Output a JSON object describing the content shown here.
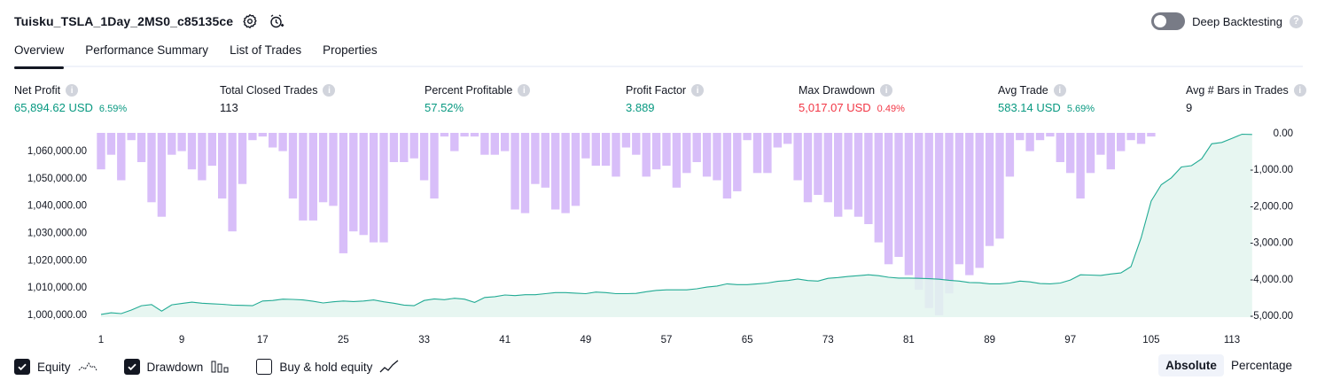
{
  "header": {
    "strategy_name": "Tuisku_TSLA_1Day_2MS0_c85135ce",
    "settings_icon": "gear-icon",
    "alert_icon": "alarm-plus-icon",
    "deep_backtesting_label": "Deep Backtesting",
    "deep_backtesting_enabled": false,
    "help_glyph": "?"
  },
  "tabs": [
    {
      "label": "Overview",
      "active": true
    },
    {
      "label": "Performance Summary",
      "active": false
    },
    {
      "label": "List of Trades",
      "active": false
    },
    {
      "label": "Properties",
      "active": false
    }
  ],
  "metrics": {
    "info_glyph": "i",
    "net_profit": {
      "label": "Net Profit",
      "value": "65,894.62 USD",
      "pct": "6.59%"
    },
    "total_closed_trades": {
      "label": "Total Closed Trades",
      "value": "113"
    },
    "percent_profitable": {
      "label": "Percent Profitable",
      "value": "57.52%"
    },
    "profit_factor": {
      "label": "Profit Factor",
      "value": "3.889"
    },
    "max_drawdown": {
      "label": "Max Drawdown",
      "value": "5,017.07 USD",
      "pct": "0.49%"
    },
    "avg_trade": {
      "label": "Avg Trade",
      "value": "583.14 USD",
      "pct": "5.69%"
    },
    "avg_bars_in_trades": {
      "label": "Avg # Bars in Trades",
      "value": "9"
    }
  },
  "colors": {
    "profit": "#089981",
    "loss": "#f23645",
    "equity_line": "#22ab94",
    "equity_fill": "#e3f4ef",
    "drawdown_bar": "#d1b3f8"
  },
  "chart_data": {
    "type": "area",
    "x_ticks": [
      "1",
      "9",
      "17",
      "25",
      "33",
      "41",
      "49",
      "57",
      "65",
      "73",
      "81",
      "89",
      "97",
      "105",
      "113"
    ],
    "x_range": [
      1,
      113
    ],
    "left_axis": {
      "ticks": [
        "1,000,000.00",
        "1,010,000.00",
        "1,020,000.00",
        "1,030,000.00",
        "1,040,000.00",
        "1,050,000.00",
        "1,060,000.00"
      ],
      "range": [
        999000,
        1066500
      ]
    },
    "right_axis": {
      "ticks": [
        "0.00",
        "-1,000.00",
        "-2,000.00",
        "-3,000.00",
        "-4,000.00",
        "-5,000.00"
      ],
      "range": [
        -5050,
        0
      ]
    },
    "series": [
      {
        "name": "Equity",
        "type": "area",
        "values": [
          1000000,
          1000600,
          1000300,
          1001600,
          1003200,
          1003600,
          1001200,
          1003500,
          1004000,
          1004500,
          1004100,
          1003900,
          1003700,
          1003400,
          1003300,
          1003200,
          1004900,
          1005100,
          1005600,
          1005500,
          1005300,
          1004800,
          1004200,
          1004600,
          1004900,
          1004700,
          1004900,
          1005300,
          1004600,
          1004100,
          1003400,
          1003200,
          1005100,
          1005700,
          1005400,
          1005900,
          1005600,
          1004400,
          1006200,
          1006500,
          1007100,
          1006900,
          1007200,
          1007200,
          1007600,
          1008000,
          1008000,
          1007800,
          1007600,
          1008200,
          1008000,
          1007600,
          1007600,
          1007700,
          1008300,
          1008800,
          1009000,
          1009000,
          1009000,
          1009400,
          1010000,
          1010400,
          1011200,
          1010900,
          1010900,
          1011200,
          1011500,
          1012100,
          1012400,
          1013000,
          1012400,
          1012200,
          1013200,
          1013500,
          1013900,
          1014200,
          1014500,
          1014200,
          1013600,
          1013300,
          1013300,
          1013200,
          1013100,
          1012900,
          1012500,
          1012200,
          1011700,
          1011600,
          1011200,
          1011200,
          1011500,
          1012200,
          1011900,
          1011300,
          1011200,
          1011500,
          1012600,
          1014500,
          1014400,
          1014300,
          1014800,
          1015200,
          1017500,
          1028000,
          1041500,
          1047500,
          1050000,
          1054000,
          1054500,
          1057000,
          1062500,
          1063000,
          1064500,
          1066000,
          1065900
        ],
        "color": "#22ab94"
      },
      {
        "name": "Drawdown",
        "type": "bar",
        "values": [
          -1000,
          -600,
          -1300,
          -200,
          -800,
          -1900,
          -2300,
          -600,
          -500,
          -1000,
          -1300,
          -900,
          -1800,
          -2700,
          -1400,
          -200,
          -100,
          -400,
          -500,
          -1800,
          -2400,
          -2400,
          -1900,
          -2000,
          -3300,
          -2700,
          -2800,
          -3000,
          -3000,
          -800,
          -800,
          -700,
          -1300,
          -1800,
          -100,
          -500,
          -100,
          -100,
          -600,
          -600,
          -500,
          -2100,
          -2200,
          -1400,
          -1500,
          -2100,
          -2200,
          -2000,
          -700,
          -900,
          -900,
          -1200,
          -400,
          -600,
          -1200,
          -1000,
          -900,
          -1500,
          -1100,
          -800,
          -1200,
          -1300,
          -1800,
          -1600,
          -200,
          -1100,
          -1100,
          -400,
          -300,
          -1300,
          -1900,
          -1700,
          -1900,
          -2300,
          -2100,
          -2300,
          -2500,
          -3000,
          -3600,
          -3400,
          -3900,
          -4300,
          -4800,
          -5000,
          -4400,
          -3600,
          -3900,
          -3700,
          -3100,
          -2900,
          -1200,
          -200,
          -500,
          -200,
          -100,
          -800,
          -1100,
          -1800,
          -1100,
          -600,
          -1000,
          -500,
          -200,
          -300,
          -100
        ],
        "color": "#d1b3f8"
      }
    ]
  },
  "legend": {
    "equity": {
      "label": "Equity",
      "checked": true,
      "icon": "equity-line-icon"
    },
    "drawdown": {
      "label": "Drawdown",
      "checked": true,
      "icon": "drawdown-bars-icon"
    },
    "buy_hold": {
      "label": "Buy & hold equity",
      "checked": false,
      "icon": "buy-hold-line-icon"
    }
  },
  "mode_switch": {
    "absolute_label": "Absolute",
    "percentage_label": "Percentage",
    "selected": "absolute"
  }
}
